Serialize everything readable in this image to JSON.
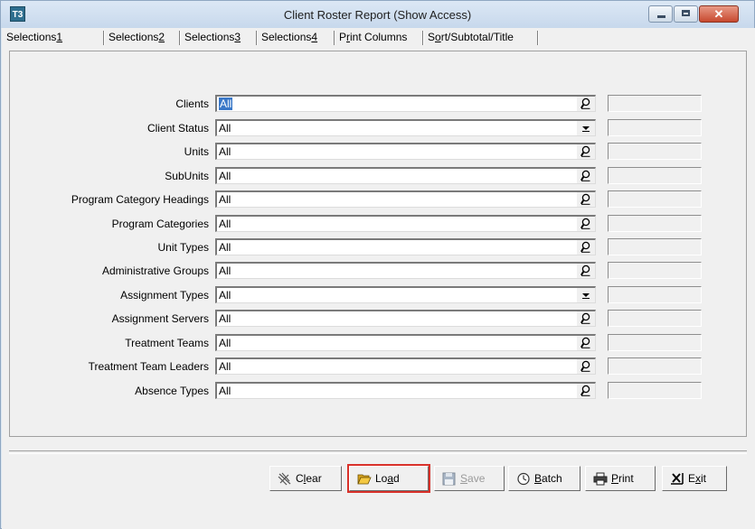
{
  "window": {
    "title": "Client Roster Report (Show Access)",
    "icon": "app-icon",
    "icon_text": "T3",
    "close_glyph": "✕"
  },
  "tabs": [
    {
      "label_pre": "Selections",
      "label_u": "1",
      "label_post": ""
    },
    {
      "label_pre": "Selections",
      "label_u": "2",
      "label_post": ""
    },
    {
      "label_pre": "Selections",
      "label_u": "3",
      "label_post": ""
    },
    {
      "label_pre": "Selections",
      "label_u": "4",
      "label_post": ""
    },
    {
      "label_pre": "P",
      "label_u": "r",
      "label_post": "int Columns"
    },
    {
      "label_pre": "S",
      "label_u": "o",
      "label_post": "rt/Subtotal/Title"
    }
  ],
  "fields": [
    {
      "label": "Clients",
      "value": "All",
      "control": "lookup"
    },
    {
      "label": "Client Status",
      "value": "All",
      "control": "dropdown"
    },
    {
      "label": "Units",
      "value": "All",
      "control": "lookup"
    },
    {
      "label": "SubUnits",
      "value": "All",
      "control": "lookup"
    },
    {
      "label": "Program Category Headings",
      "value": "All",
      "control": "lookup"
    },
    {
      "label": "Program Categories",
      "value": "All",
      "control": "lookup"
    },
    {
      "label": "Unit Types",
      "value": "All",
      "control": "lookup"
    },
    {
      "label": "Administrative Groups",
      "value": "All",
      "control": "lookup"
    },
    {
      "label": "Assignment Types",
      "value": "All",
      "control": "dropdown"
    },
    {
      "label": "Assignment Servers",
      "value": "All",
      "control": "lookup"
    },
    {
      "label": "Treatment Teams",
      "value": "All",
      "control": "lookup"
    },
    {
      "label": "Treatment Team Leaders",
      "value": "All",
      "control": "lookup"
    },
    {
      "label": "Absence Types",
      "value": "All",
      "control": "lookup"
    }
  ],
  "buttons": {
    "clear": {
      "pre": "C",
      "u": "l",
      "post": "ear",
      "icon": "broom-icon"
    },
    "load": {
      "pre": "Lo",
      "u": "a",
      "post": "d",
      "icon": "open-folder-icon"
    },
    "save": {
      "pre": "",
      "u": "S",
      "post": "ave",
      "icon": "floppy-disk-icon"
    },
    "batch": {
      "pre": "",
      "u": "B",
      "post": "atch",
      "icon": "clock-icon"
    },
    "print": {
      "pre": "",
      "u": "P",
      "post": "rint",
      "icon": "printer-icon"
    },
    "exit": {
      "pre": "E",
      "u": "x",
      "post": "it",
      "icon": "exit-x-icon"
    }
  },
  "colors": {
    "selection": "#3a78c8",
    "highlight_border": "#d9312a"
  }
}
